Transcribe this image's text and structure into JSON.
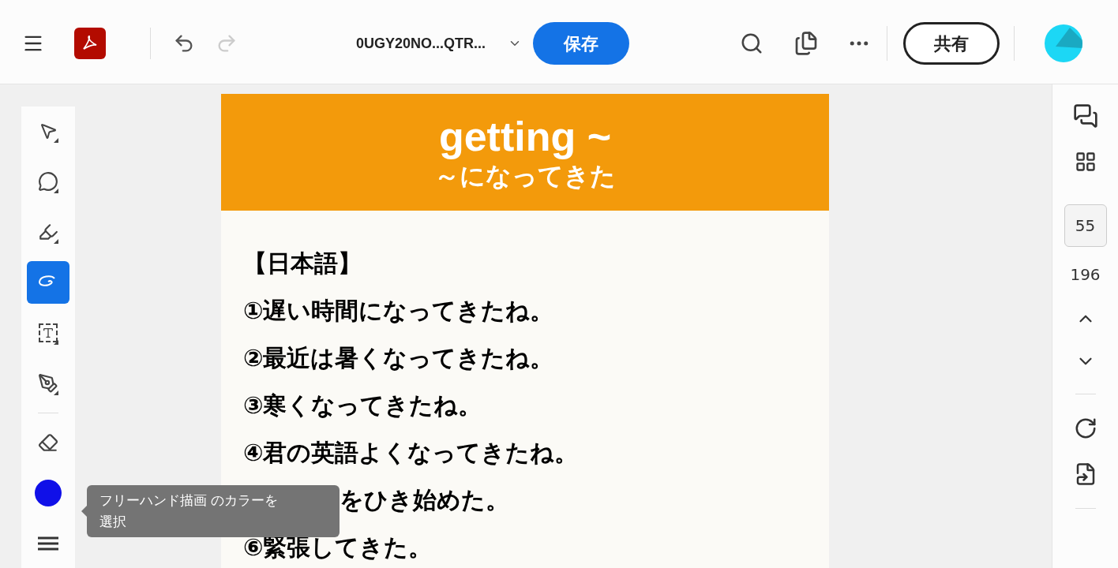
{
  "toolbar": {
    "file_name": "0UGY20NO...QTR...",
    "save_label": "保存",
    "share_label": "共有"
  },
  "tools": [
    {
      "kind": "select",
      "selected": false
    },
    {
      "kind": "comment",
      "selected": false
    },
    {
      "kind": "highlight",
      "selected": false
    },
    {
      "kind": "draw",
      "selected": true
    },
    {
      "kind": "textbox",
      "selected": false
    },
    {
      "kind": "sign",
      "selected": false
    },
    {
      "kind": "eraser",
      "selected": false
    },
    {
      "kind": "color",
      "selected": false,
      "color": "#1010e8"
    },
    {
      "kind": "lines",
      "selected": false
    }
  ],
  "tooltip": {
    "lines": [
      "フリーハンド描画 のカラーを",
      "選択"
    ]
  },
  "document": {
    "title": "getting ~",
    "subtitle": "～になってきた",
    "heading": "【日本語】",
    "lines": [
      "①遅い時間になってきたね。",
      "②最近は暑くなってきたね。",
      "③寒くなってきたね。",
      "④君の英語よくなってきたね。"
    ],
    "partial_line": "をひき始めた。",
    "more_lines": [
      "⑥緊張してきた。"
    ]
  },
  "pager": {
    "current": "55",
    "total": "196"
  }
}
